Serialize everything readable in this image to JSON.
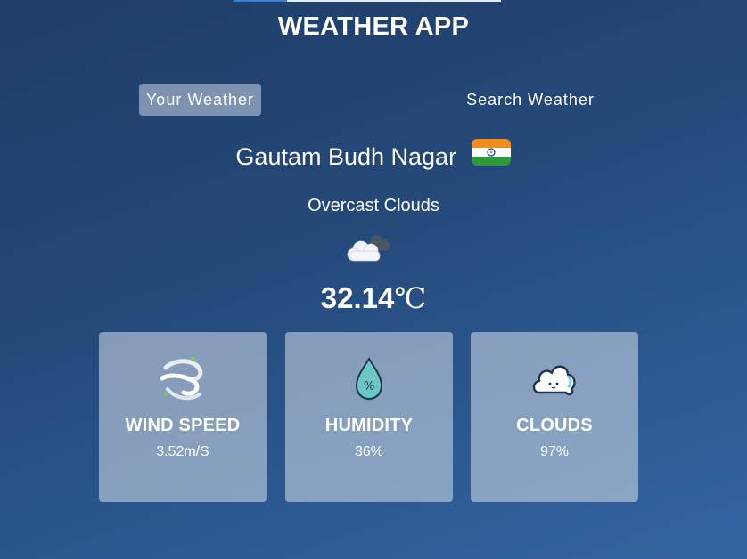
{
  "app": {
    "title": "WEATHER APP"
  },
  "tabs": [
    {
      "label": "Your Weather",
      "active": true
    },
    {
      "label": "Search Weather",
      "active": false
    }
  ],
  "location": {
    "city": "Gautam Budh Nagar",
    "country_flag_icon": "india-flag-icon"
  },
  "weather": {
    "description": "Overcast Clouds",
    "icon": "overcast-clouds-icon",
    "temperature_value": "32.14",
    "temperature_unit": "℃"
  },
  "stats": [
    {
      "label": "WIND SPEED",
      "value": "3.52m/S",
      "icon": "wind-icon"
    },
    {
      "label": "HUMIDITY",
      "value": "36%",
      "icon": "humidity-drop-icon"
    },
    {
      "label": "CLOUDS",
      "value": "97%",
      "icon": "cloud-icon"
    }
  ],
  "colors": {
    "background_top": "#1f3d68",
    "background_bottom": "#3464a0",
    "panel": "#ccd6e4",
    "text": "#ffffff"
  }
}
